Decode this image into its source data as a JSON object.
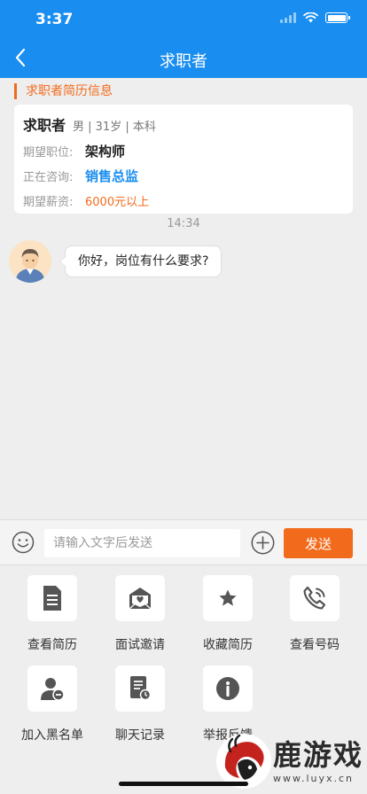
{
  "status_bar": {
    "time": "3:37"
  },
  "nav": {
    "title": "求职者"
  },
  "resume": {
    "section_title": "求职者简历信息",
    "name": "求职者",
    "meta": "男 | 31岁 | 本科",
    "position_label": "期望职位:",
    "position_value": "架构师",
    "consult_label": "正在咨询:",
    "consult_value": "销售总监",
    "salary_label": "期望薪资:",
    "salary_value": "6000元以上"
  },
  "chat": {
    "timestamp": "14:34",
    "messages": [
      {
        "text": "你好，岗位有什么要求?"
      }
    ]
  },
  "input": {
    "placeholder": "请输入文字后发送",
    "send_label": "发送"
  },
  "actions": [
    {
      "label": "查看简历",
      "icon": "document-icon"
    },
    {
      "label": "面试邀请",
      "icon": "mail-heart-icon"
    },
    {
      "label": "收藏简历",
      "icon": "star-icon"
    },
    {
      "label": "查看号码",
      "icon": "phone-icon"
    },
    {
      "label": "加入黑名单",
      "icon": "user-block-icon"
    },
    {
      "label": "聊天记录",
      "icon": "chat-log-icon"
    },
    {
      "label": "举报反馈",
      "icon": "info-icon"
    }
  ],
  "watermark": {
    "name": "鹿游戏",
    "url": "www.luyx.cn"
  },
  "colors": {
    "header": "#1a8ef0",
    "accent": "#f26b1d",
    "link": "#1a8ef0"
  }
}
